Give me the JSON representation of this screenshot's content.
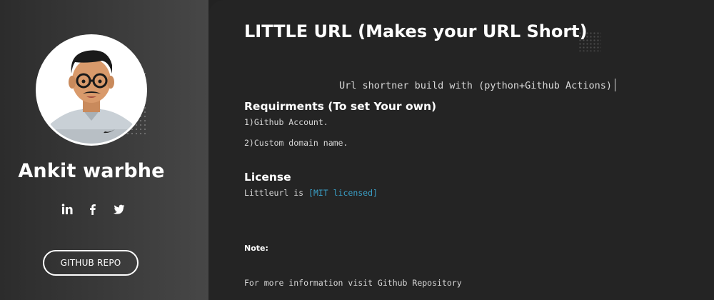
{
  "sidebar": {
    "name": "Ankit warbhe",
    "social_icons": [
      "linkedin-icon",
      "facebook-icon",
      "twitter-icon"
    ],
    "button_label": "GITHUB REPO"
  },
  "main": {
    "title": "LITTLE URL (Makes your URL Short)",
    "subtitle": "Url shortner build with (python+Github Actions)",
    "requirements_heading": "Requirments (To set Your own)",
    "requirements": [
      "1)Github Account.",
      "2)Custom domain name."
    ],
    "license_heading": "License",
    "license_text_prefix": "Littleurl is ",
    "license_link": "[MIT licensed]",
    "note_label": "Note:",
    "note_text": "For more information visit Github Repository"
  },
  "colors": {
    "sidebar_gradient_start": "#2c2c2c",
    "sidebar_gradient_end": "#474747",
    "main_bg": "#242424",
    "link": "#3aa0c8",
    "text": "#ffffff"
  }
}
